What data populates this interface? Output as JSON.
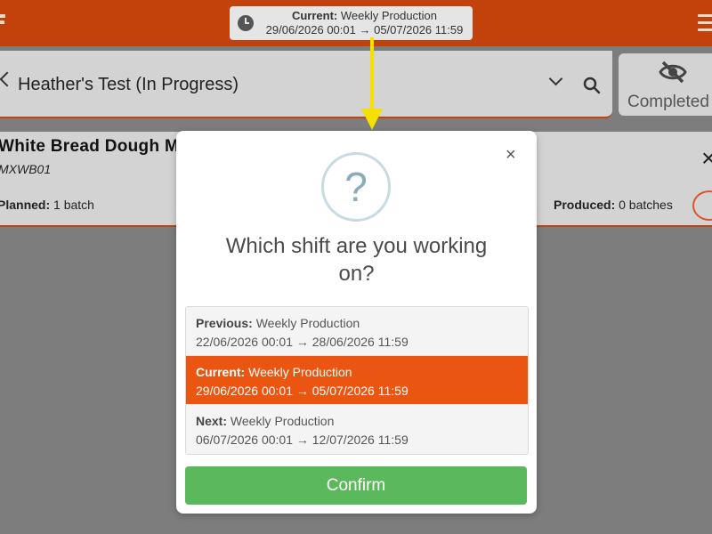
{
  "header": {
    "current_shift": {
      "label": "Current:",
      "name": "Weekly Production",
      "range": "29/06/2026 00:01 → 05/07/2026 11:59"
    }
  },
  "search": {
    "title": "Heather's Test (In Progress)"
  },
  "completed_toggle": {
    "label": "Completed"
  },
  "product": {
    "name": "White Bread Dough M",
    "code": "MXWB01",
    "planned_label": "Planned:",
    "planned_value": "1 batch",
    "produced_label": "Produced:",
    "produced_value": "0 batches"
  },
  "modal": {
    "close": "×",
    "icon_text": "?",
    "title": "Which shift are you working on?",
    "shifts": [
      {
        "label": "Previous:",
        "name": "Weekly Production",
        "range": "22/06/2026 00:01 → 28/06/2026 11:59",
        "selected": false
      },
      {
        "label": "Current:",
        "name": "Weekly Production",
        "range": "29/06/2026 00:01 → 05/07/2026 11:59",
        "selected": true
      },
      {
        "label": "Next:",
        "name": "Weekly Production",
        "range": "06/07/2026 00:01 → 12/07/2026 11:59",
        "selected": false
      }
    ],
    "confirm_label": "Confirm"
  },
  "colors": {
    "brand": "#c3420b",
    "selected_row": "#ea5512",
    "confirm": "#5cb85c",
    "annotation_arrow": "#f5e000"
  }
}
